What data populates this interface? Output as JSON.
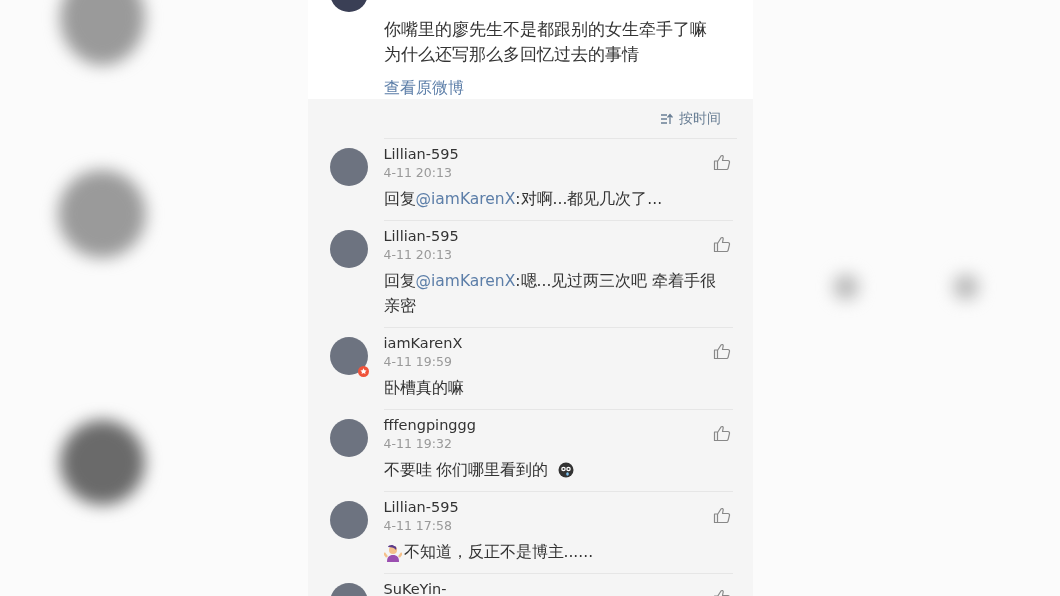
{
  "post": {
    "text_lines": [
      "你嘴里的廖先生不是都跟别的女生牵手了嘛",
      "为什么还写那么多回忆过去的事情"
    ],
    "link": "查看原微博"
  },
  "sort": {
    "label": "按时间"
  },
  "comments": [
    {
      "user": "Lillian-595",
      "time": "4-11 20:13",
      "prefix": "回复",
      "mention": "@iamKarenX",
      "text": ":对啊...都见几次了...",
      "verified": false,
      "lead_emoji": false,
      "trail_emoji": false
    },
    {
      "user": "Lillian-595",
      "time": "4-11 20:13",
      "prefix": "回复",
      "mention": "@iamKarenX",
      "text": ":嗯...见过两三次吧 牵着手很亲密",
      "verified": false,
      "lead_emoji": false,
      "trail_emoji": false
    },
    {
      "user": "iamKarenX",
      "time": "4-11 19:59",
      "text": "卧槽真的嘛",
      "verified": true,
      "lead_emoji": false,
      "trail_emoji": false
    },
    {
      "user": "fffengpinggg",
      "time": "4-11 19:32",
      "text": "不要哇 你们哪里看到的",
      "verified": false,
      "lead_emoji": false,
      "trail_emoji": true
    },
    {
      "user": "Lillian-595",
      "time": "4-11 17:58",
      "text": "不知道，反正不是博主......",
      "verified": false,
      "lead_emoji": true,
      "trail_emoji": false
    },
    {
      "user": "SuKeYin-",
      "verified": false,
      "lead_emoji": false,
      "trail_emoji": false
    }
  ]
}
